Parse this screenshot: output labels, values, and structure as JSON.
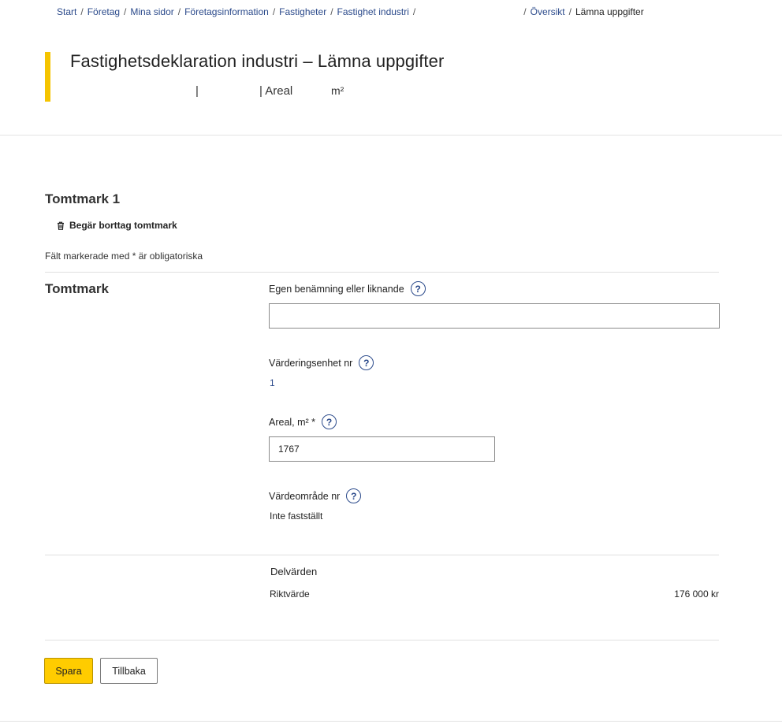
{
  "breadcrumb": {
    "items": [
      "Start",
      "Företag",
      "Mina sidor",
      "Företagsinformation",
      "Fastigheter",
      "Fastighet industri",
      "Översikt"
    ],
    "current": "Lämna uppgifter",
    "separator": "/"
  },
  "header": {
    "title": "Fastighetsdeklaration industri – Lämna uppgifter",
    "meta_separator": "|",
    "area_label": "Areal",
    "area_unit": "m²"
  },
  "plot": {
    "title": "Tomtmark 1",
    "remove_label": "Begär borttag tomtmark",
    "mandatory_note": "Fält markerade med * är obligatoriska"
  },
  "section": {
    "title": "Tomtmark",
    "fields": {
      "name": {
        "label": "Egen benämning eller liknande",
        "value": ""
      },
      "valuation_unit": {
        "label": "Värderingsenhet nr",
        "value": "1"
      },
      "area": {
        "label": "Areal, m² *",
        "value": "1767"
      },
      "value_area": {
        "label": "Värdeområde nr",
        "value": "Inte fastställt"
      }
    },
    "help_glyph": "?"
  },
  "partial_values": {
    "title": "Delvärden",
    "rows": [
      {
        "label": "Riktvärde",
        "value": "176 000 kr"
      }
    ]
  },
  "actions": {
    "save": "Spara",
    "back": "Tillbaka"
  },
  "colors": {
    "accent": "#f5c400",
    "link": "#2b4a8b",
    "primary_button": "#ffcc00"
  }
}
